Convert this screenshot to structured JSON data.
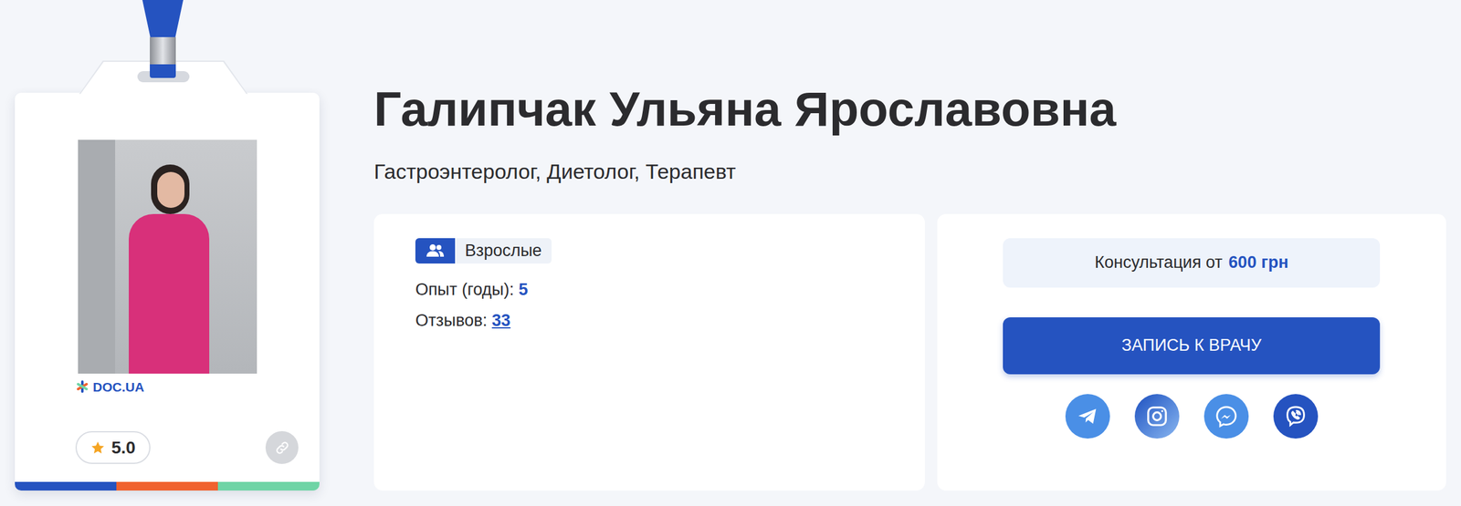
{
  "doctor": {
    "name": "Галипчак Ульяна Ярославовна",
    "specialties": "Гастроэнтеролог, Диетолог, Терапевт",
    "logo": "DOC.UA",
    "rating": "5.0"
  },
  "info": {
    "audience": "Взрослые",
    "experience_label": "Опыт (годы):",
    "experience_value": "5",
    "reviews_label": "Отзывов:",
    "reviews_value": "33"
  },
  "booking": {
    "price_label": "Консультация от",
    "price_value": "600 грн",
    "button": "ЗАПИСЬ К ВРАЧУ"
  }
}
